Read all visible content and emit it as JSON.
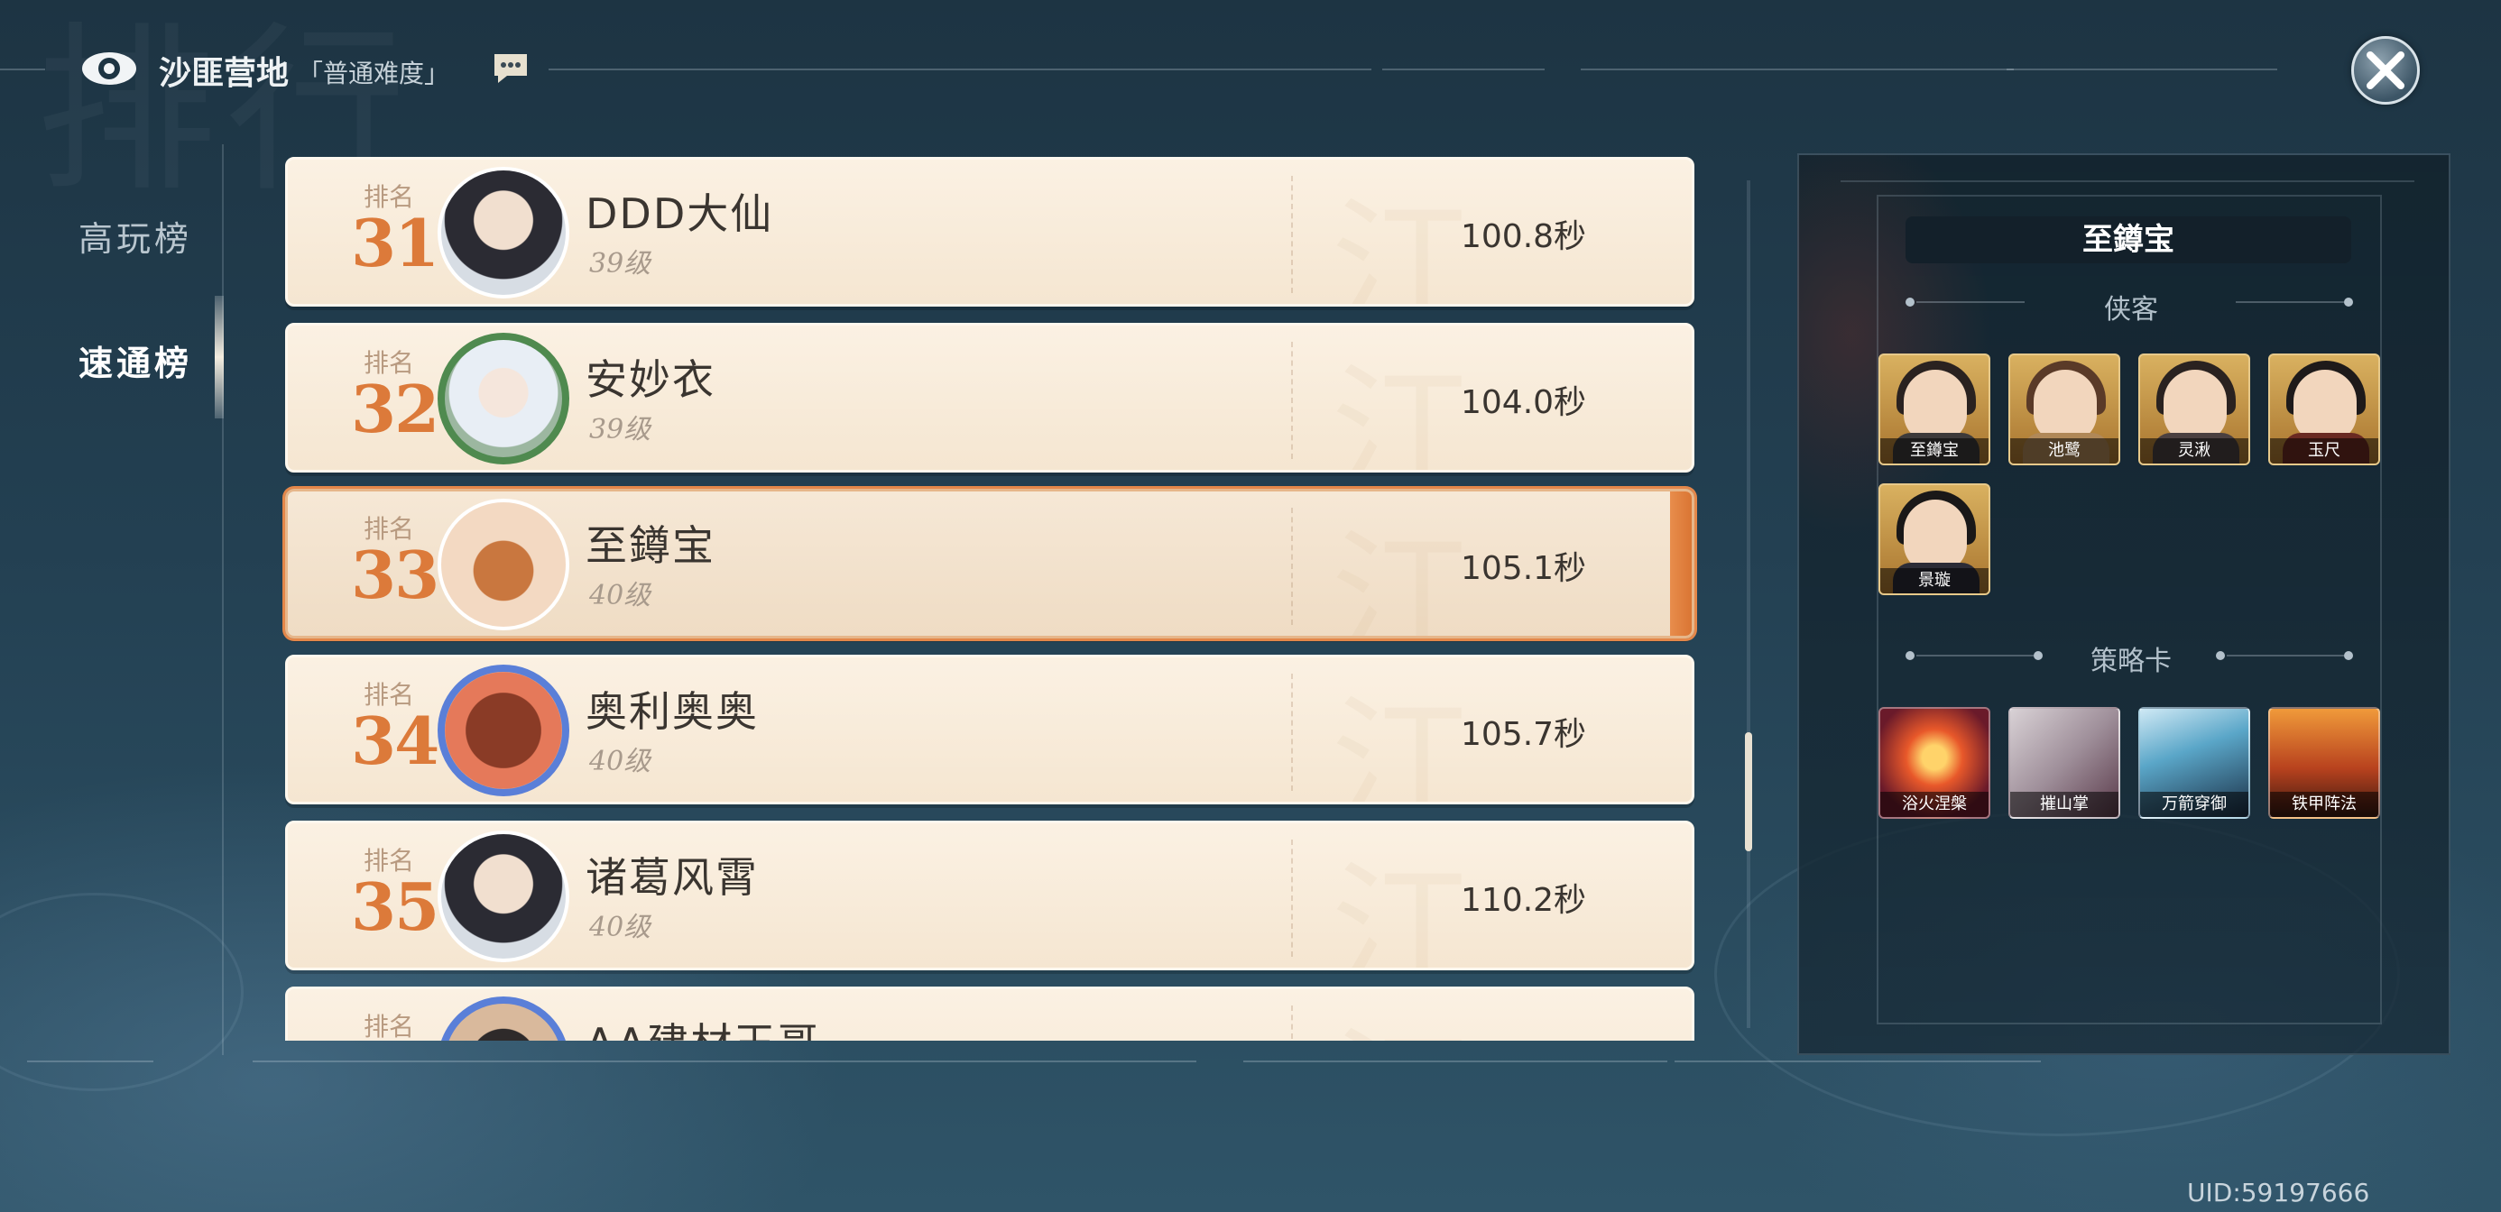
{
  "header": {
    "title": "沙匪营地",
    "difficulty": "「普通难度」"
  },
  "tabs": [
    {
      "label": "高玩榜",
      "active": false
    },
    {
      "label": "速通榜",
      "active": true
    }
  ],
  "rankings": [
    {
      "rank_label": "排名",
      "rank": "31",
      "name": "DDD大仙",
      "level": "39级",
      "time": "100.8秒",
      "selected": false
    },
    {
      "rank_label": "排名",
      "rank": "32",
      "name": "安妙衣",
      "level": "39级",
      "time": "104.0秒",
      "selected": false
    },
    {
      "rank_label": "排名",
      "rank": "33",
      "name": "至鐏宝",
      "level": "40级",
      "time": "105.1秒",
      "selected": true
    },
    {
      "rank_label": "排名",
      "rank": "34",
      "name": "奥利奥奥",
      "level": "40级",
      "time": "105.7秒",
      "selected": false
    },
    {
      "rank_label": "排名",
      "rank": "35",
      "name": "诸葛风霄",
      "level": "40级",
      "time": "110.2秒",
      "selected": false
    },
    {
      "rank_label": "排名",
      "rank": "",
      "name": "AA建材王哥",
      "level": "",
      "time": "",
      "selected": false
    }
  ],
  "detail": {
    "player_name": "至鐏宝",
    "heroes_title": "侠客",
    "heroes": [
      "至鐏宝",
      "池鹭",
      "灵湫",
      "玉尺",
      "景璇"
    ],
    "cards_title": "策略卡",
    "cards": [
      "浴火涅槃",
      "摧山掌",
      "万箭穿御",
      "铁甲阵法"
    ]
  },
  "uid": "UID:59197666",
  "colors": {
    "accent": "#dc7a3a",
    "row_bg": "#f8ecdb",
    "selected_border": "#e3874a"
  },
  "icons": [
    "eye-icon",
    "chat-icon",
    "close-icon"
  ]
}
